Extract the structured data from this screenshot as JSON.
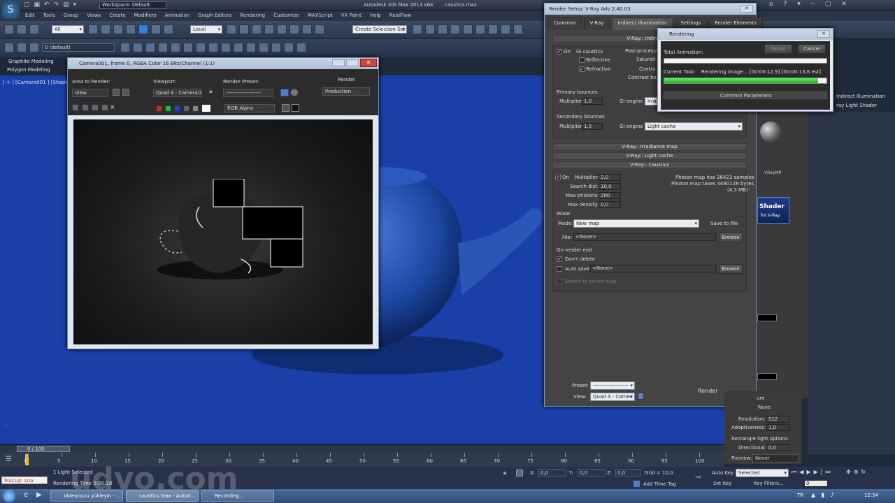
{
  "app": {
    "title": "Autodesk 3ds Max 2013 x64",
    "filename": "caustics.max",
    "workspace": "Workspace: Default",
    "menu": [
      "Edit",
      "Tools",
      "Group",
      "Views",
      "Create",
      "Modifiers",
      "Animation",
      "Graph Editors",
      "Rendering",
      "Customize",
      "MAXScript",
      "VX Paint",
      "Help",
      "RealFlow"
    ],
    "toolbar": {
      "filter": "All",
      "coord": "Local",
      "selset": "Create Selection Set",
      "layer": "0 (default)"
    },
    "ribbon": {
      "graphite": "Graphite Modeling",
      "polygon": "Polygon Modeling"
    },
    "viewport_label": "[ + ] [Camera001 ] [Shaded ]"
  },
  "frame_window": {
    "title": "Camera001, frame 0, RGBA Color 16 Bits/Channel (1:1)",
    "area_label": "Area to Render:",
    "area_value": "View",
    "viewport_label": "Viewport:",
    "viewport_value": "Quad 4 - Camera001",
    "preset_label": "Render Preset:",
    "preset_value": "--------------------",
    "render_btn": "Render",
    "production": "Production",
    "channel": "RGB Alpha"
  },
  "render_setup": {
    "title": "Render Setup: V-Ray Adv 2.40.03",
    "tabs": [
      "Common",
      "V-Ray",
      "Indirect illumination",
      "Settings",
      "Render Elements"
    ],
    "gi_rollout": "V-Ray:: Indirect il...",
    "on": "On",
    "gi_caustics": "GI caustics",
    "reflective": "Reflective",
    "refractive": "Refractive",
    "post_processing": "Post-processi...",
    "saturation": "Saturati...",
    "contrast": "Contra...",
    "contrast_base": "Contrast ba...",
    "primary_bounces": "Primary bounces",
    "multiplier": "Multiplier",
    "primary_mult": "1,0",
    "gi_engine": "GI engine",
    "primary_engine": "Irra...",
    "secondary_bounces": "Secondary bounces",
    "secondary_mult": "1,0",
    "secondary_engine": "Light cache",
    "rollouts": [
      "V-Ray:: Irradiance map",
      "V-Ray:: Light cache",
      "V-Ray:: Caustics"
    ],
    "caustics": {
      "on": "On",
      "multiplier_label": "Multiplier:",
      "multiplier": "2,0",
      "search_label": "Search dist:",
      "search": "10,0",
      "maxphotons_label": "Max photons:",
      "maxphotons": "200",
      "maxdensity_label": "Max density:",
      "maxdensity": "0,0",
      "photon_info1": "Photon map has 36423 samples",
      "photon_info2": "Photon map takes 4480128 bytes",
      "photon_info3": "(4,3 MB)",
      "mode_header": "Mode",
      "mode_label": "Mode:",
      "mode_value": "New map",
      "save_to_file": "Save to file",
      "file_label": "File:",
      "file_value": "<None>",
      "browse": "Browse",
      "on_render_end": "On render end",
      "dont_delete": "Don't delete",
      "auto_save_label": "Auto save:",
      "auto_save_value": "<None>",
      "browse2": "Browse",
      "switch_saved": "Switch to saved map"
    },
    "footer": {
      "preset_label": "Preset:",
      "preset_value": "--------------------",
      "view_label": "View:",
      "view_value": "Quad 4 - Camer",
      "render": "Render"
    }
  },
  "rendering_dialog": {
    "title": "Rendering",
    "pause": "Pause",
    "cancel": "Cancel",
    "total_animation": "Total Animation:",
    "current_task_label": "Current Task:",
    "current_task": "Rendering image... [00:00:12,9] [00:00:13,6 est]",
    "progress": 0.95,
    "common_params": "Common Parameters"
  },
  "side_panel": {
    "vray_label": "VRayMtl",
    "shader_badge": "Shader",
    "shader_sub": "for V-Ray",
    "indirect": "Indirect Illumination",
    "light_shader": "ray Light Shader",
    "resolution_label": "Resolution:",
    "resolution": "512",
    "adaptiveness_label": "Adaptiveness:",
    "adaptiveness": "1,0",
    "rect_options": "Rectangle light options",
    "directional_label": "Directional:",
    "directional": "0,0",
    "preview_label": "Preview:",
    "preview": "Never",
    "none": "None",
    "ure": "ure"
  },
  "timeline": {
    "frame": "0 / 100",
    "ticks": [
      0,
      5,
      10,
      15,
      20,
      25,
      30,
      35,
      40,
      45,
      50,
      55,
      60,
      65,
      70,
      75,
      80,
      85,
      90,
      95,
      100
    ],
    "status1": "1 Light Selected",
    "status2": "Rendering Time 0:00:18",
    "x_label": "X:",
    "x_value": "0,0",
    "y_label": "Y:",
    "y_value": "0,0",
    "z_label": "Z:",
    "z_value": "0,0",
    "grid": "Grid = 10,0",
    "auto_key": "Auto Key",
    "selected": "Selected",
    "set_key": "Set Key",
    "key_filters": "Key Filters...",
    "add_time_tag": "Add Time Tag",
    "maxscript": "TeaCup: Loa",
    "frame_num": "0"
  },
  "taskbar": {
    "items": [
      "Videonuzu yükleyin - ...",
      "caustics.max - Autod...",
      "Recording..."
    ],
    "lang": "TR",
    "clock": "12:54"
  },
  "watermark": "udvo.com",
  "colors": {
    "viewport_blue": "#1a3fa8",
    "progress_green": "#2fd12f",
    "panel_gray": "#444444"
  }
}
